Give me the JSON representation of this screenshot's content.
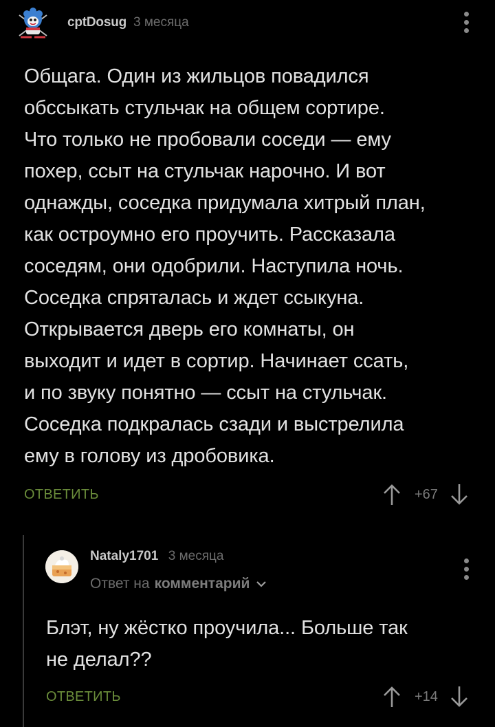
{
  "comment": {
    "username": "cptDosug",
    "time": "3 месяца",
    "text": "Общага. Один из жильцов повадился обссыкать стульчак на общем сортире. Что только не пробовали соседи — ему похер, ссыт на стульчак нарочно. И вот однажды, соседка придумала хитрый план, как остроумно его проучить. Рассказала соседям, они одобрили. Наступила ночь. Соседка спряталась и ждет ссыкуна. Открывается дверь его комнаты, он выходит и идет в сортир. Начинает ссать, и по звуку понятно — ссыт на стульчак. Соседка подкралась сзади и выстрелила ему в голову из дробовика.",
    "lines": [
      "Общага. Один из жильцов повадился",
      "обссыкать стульчак на общем сортире.",
      "Что только не пробовали соседи — ему",
      "похер, ссыт на стульчак нарочно. И вот",
      "однажды, соседка придумала хитрый план,",
      "как остроумно его проучить. Рассказала",
      "соседям, они одобрили. Наступила ночь.",
      "Соседка спряталась и ждет ссыкуна.",
      "Открывается дверь его комнаты, он",
      "выходит и идет в сортир. Начинает ссать,",
      "и по звуку понятно — ссыт на стульчак.",
      "Соседка подкралась сзади и выстрелила",
      "ему в голову из дробовика."
    ],
    "reply_label": "ОТВЕТИТЬ",
    "score": "+67",
    "upvote_icon": "arrow-up-icon",
    "downvote_icon": "arrow-down-icon",
    "more_icon": "more-vertical-icon"
  },
  "reply": {
    "username": "Nataly1701",
    "time": "3 месяца",
    "reply_prefix": "Ответ на",
    "reply_link": "комментарий",
    "lines": [
      "Блэт, ну жёстко проучила... Больше так",
      "не делал??"
    ],
    "reply_label": "ОТВЕТИТЬ",
    "score": "+14"
  },
  "colors": {
    "background": "#000000",
    "text": "#e2e2e2",
    "muted": "#6c6c6c",
    "reply_green": "#6a8c3a",
    "thread_line": "#3a3a3a"
  }
}
